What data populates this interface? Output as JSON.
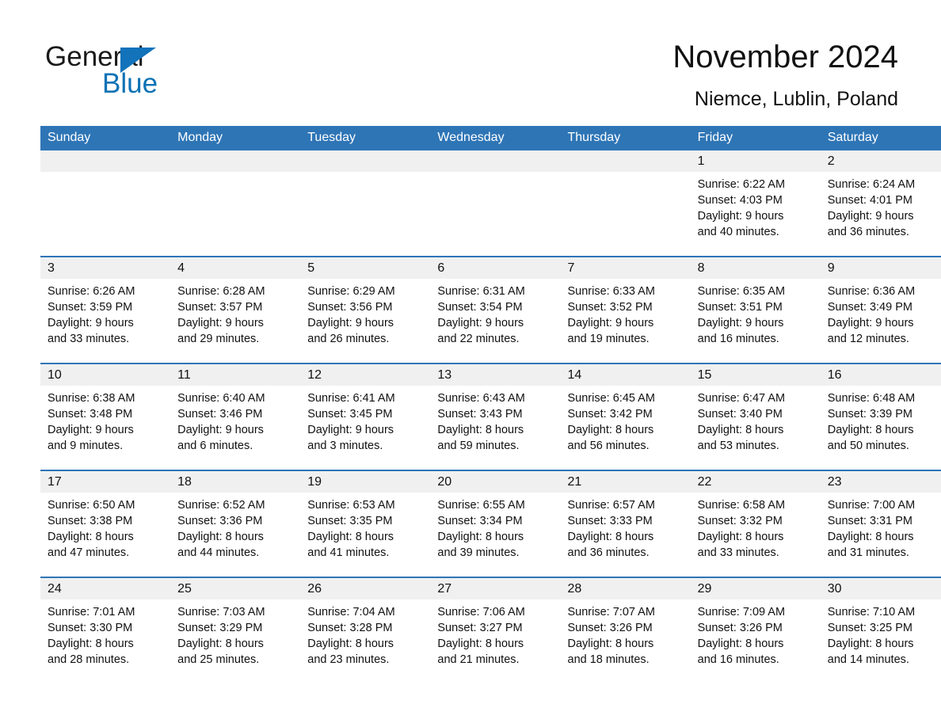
{
  "brand": {
    "name_part1": "General",
    "name_part2": "Blue",
    "triangle_color": "#1273ba",
    "blue_color": "#0b72b5"
  },
  "header": {
    "title": "November 2024",
    "subtitle": "Niemce, Lublin, Poland",
    "header_bg": "#2e75b6",
    "daynum_bg": "#f0f0f0"
  },
  "weekdays": [
    "Sunday",
    "Monday",
    "Tuesday",
    "Wednesday",
    "Thursday",
    "Friday",
    "Saturday"
  ],
  "weeks": [
    [
      {
        "date": "",
        "sunrise": "",
        "sunset": "",
        "daylight1": "",
        "daylight2": ""
      },
      {
        "date": "",
        "sunrise": "",
        "sunset": "",
        "daylight1": "",
        "daylight2": ""
      },
      {
        "date": "",
        "sunrise": "",
        "sunset": "",
        "daylight1": "",
        "daylight2": ""
      },
      {
        "date": "",
        "sunrise": "",
        "sunset": "",
        "daylight1": "",
        "daylight2": ""
      },
      {
        "date": "",
        "sunrise": "",
        "sunset": "",
        "daylight1": "",
        "daylight2": ""
      },
      {
        "date": "1",
        "sunrise": "Sunrise: 6:22 AM",
        "sunset": "Sunset: 4:03 PM",
        "daylight1": "Daylight: 9 hours",
        "daylight2": "and 40 minutes."
      },
      {
        "date": "2",
        "sunrise": "Sunrise: 6:24 AM",
        "sunset": "Sunset: 4:01 PM",
        "daylight1": "Daylight: 9 hours",
        "daylight2": "and 36 minutes."
      }
    ],
    [
      {
        "date": "3",
        "sunrise": "Sunrise: 6:26 AM",
        "sunset": "Sunset: 3:59 PM",
        "daylight1": "Daylight: 9 hours",
        "daylight2": "and 33 minutes."
      },
      {
        "date": "4",
        "sunrise": "Sunrise: 6:28 AM",
        "sunset": "Sunset: 3:57 PM",
        "daylight1": "Daylight: 9 hours",
        "daylight2": "and 29 minutes."
      },
      {
        "date": "5",
        "sunrise": "Sunrise: 6:29 AM",
        "sunset": "Sunset: 3:56 PM",
        "daylight1": "Daylight: 9 hours",
        "daylight2": "and 26 minutes."
      },
      {
        "date": "6",
        "sunrise": "Sunrise: 6:31 AM",
        "sunset": "Sunset: 3:54 PM",
        "daylight1": "Daylight: 9 hours",
        "daylight2": "and 22 minutes."
      },
      {
        "date": "7",
        "sunrise": "Sunrise: 6:33 AM",
        "sunset": "Sunset: 3:52 PM",
        "daylight1": "Daylight: 9 hours",
        "daylight2": "and 19 minutes."
      },
      {
        "date": "8",
        "sunrise": "Sunrise: 6:35 AM",
        "sunset": "Sunset: 3:51 PM",
        "daylight1": "Daylight: 9 hours",
        "daylight2": "and 16 minutes."
      },
      {
        "date": "9",
        "sunrise": "Sunrise: 6:36 AM",
        "sunset": "Sunset: 3:49 PM",
        "daylight1": "Daylight: 9 hours",
        "daylight2": "and 12 minutes."
      }
    ],
    [
      {
        "date": "10",
        "sunrise": "Sunrise: 6:38 AM",
        "sunset": "Sunset: 3:48 PM",
        "daylight1": "Daylight: 9 hours",
        "daylight2": "and 9 minutes."
      },
      {
        "date": "11",
        "sunrise": "Sunrise: 6:40 AM",
        "sunset": "Sunset: 3:46 PM",
        "daylight1": "Daylight: 9 hours",
        "daylight2": "and 6 minutes."
      },
      {
        "date": "12",
        "sunrise": "Sunrise: 6:41 AM",
        "sunset": "Sunset: 3:45 PM",
        "daylight1": "Daylight: 9 hours",
        "daylight2": "and 3 minutes."
      },
      {
        "date": "13",
        "sunrise": "Sunrise: 6:43 AM",
        "sunset": "Sunset: 3:43 PM",
        "daylight1": "Daylight: 8 hours",
        "daylight2": "and 59 minutes."
      },
      {
        "date": "14",
        "sunrise": "Sunrise: 6:45 AM",
        "sunset": "Sunset: 3:42 PM",
        "daylight1": "Daylight: 8 hours",
        "daylight2": "and 56 minutes."
      },
      {
        "date": "15",
        "sunrise": "Sunrise: 6:47 AM",
        "sunset": "Sunset: 3:40 PM",
        "daylight1": "Daylight: 8 hours",
        "daylight2": "and 53 minutes."
      },
      {
        "date": "16",
        "sunrise": "Sunrise: 6:48 AM",
        "sunset": "Sunset: 3:39 PM",
        "daylight1": "Daylight: 8 hours",
        "daylight2": "and 50 minutes."
      }
    ],
    [
      {
        "date": "17",
        "sunrise": "Sunrise: 6:50 AM",
        "sunset": "Sunset: 3:38 PM",
        "daylight1": "Daylight: 8 hours",
        "daylight2": "and 47 minutes."
      },
      {
        "date": "18",
        "sunrise": "Sunrise: 6:52 AM",
        "sunset": "Sunset: 3:36 PM",
        "daylight1": "Daylight: 8 hours",
        "daylight2": "and 44 minutes."
      },
      {
        "date": "19",
        "sunrise": "Sunrise: 6:53 AM",
        "sunset": "Sunset: 3:35 PM",
        "daylight1": "Daylight: 8 hours",
        "daylight2": "and 41 minutes."
      },
      {
        "date": "20",
        "sunrise": "Sunrise: 6:55 AM",
        "sunset": "Sunset: 3:34 PM",
        "daylight1": "Daylight: 8 hours",
        "daylight2": "and 39 minutes."
      },
      {
        "date": "21",
        "sunrise": "Sunrise: 6:57 AM",
        "sunset": "Sunset: 3:33 PM",
        "daylight1": "Daylight: 8 hours",
        "daylight2": "and 36 minutes."
      },
      {
        "date": "22",
        "sunrise": "Sunrise: 6:58 AM",
        "sunset": "Sunset: 3:32 PM",
        "daylight1": "Daylight: 8 hours",
        "daylight2": "and 33 minutes."
      },
      {
        "date": "23",
        "sunrise": "Sunrise: 7:00 AM",
        "sunset": "Sunset: 3:31 PM",
        "daylight1": "Daylight: 8 hours",
        "daylight2": "and 31 minutes."
      }
    ],
    [
      {
        "date": "24",
        "sunrise": "Sunrise: 7:01 AM",
        "sunset": "Sunset: 3:30 PM",
        "daylight1": "Daylight: 8 hours",
        "daylight2": "and 28 minutes."
      },
      {
        "date": "25",
        "sunrise": "Sunrise: 7:03 AM",
        "sunset": "Sunset: 3:29 PM",
        "daylight1": "Daylight: 8 hours",
        "daylight2": "and 25 minutes."
      },
      {
        "date": "26",
        "sunrise": "Sunrise: 7:04 AM",
        "sunset": "Sunset: 3:28 PM",
        "daylight1": "Daylight: 8 hours",
        "daylight2": "and 23 minutes."
      },
      {
        "date": "27",
        "sunrise": "Sunrise: 7:06 AM",
        "sunset": "Sunset: 3:27 PM",
        "daylight1": "Daylight: 8 hours",
        "daylight2": "and 21 minutes."
      },
      {
        "date": "28",
        "sunrise": "Sunrise: 7:07 AM",
        "sunset": "Sunset: 3:26 PM",
        "daylight1": "Daylight: 8 hours",
        "daylight2": "and 18 minutes."
      },
      {
        "date": "29",
        "sunrise": "Sunrise: 7:09 AM",
        "sunset": "Sunset: 3:26 PM",
        "daylight1": "Daylight: 8 hours",
        "daylight2": "and 16 minutes."
      },
      {
        "date": "30",
        "sunrise": "Sunrise: 7:10 AM",
        "sunset": "Sunset: 3:25 PM",
        "daylight1": "Daylight: 8 hours",
        "daylight2": "and 14 minutes."
      }
    ]
  ]
}
